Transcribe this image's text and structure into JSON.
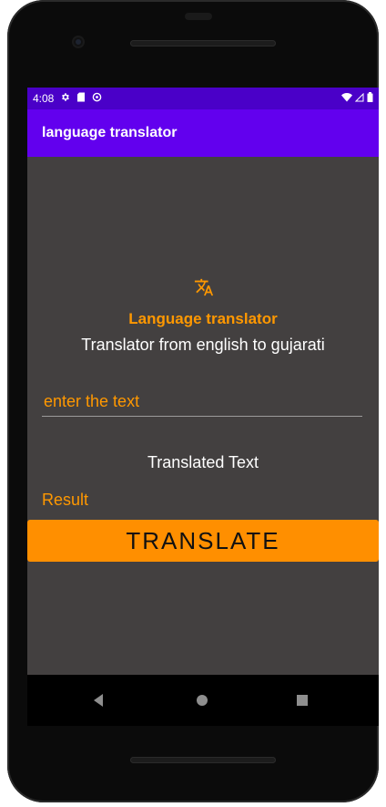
{
  "status_bar": {
    "time": "4:08",
    "left_icons": [
      "gear-icon",
      "sd-card-icon",
      "data-saver-icon"
    ],
    "right_icons": [
      "wifi-icon",
      "signal-icon",
      "battery-icon"
    ]
  },
  "app_bar": {
    "title": "language translator"
  },
  "main": {
    "icon": "translate-icon",
    "heading": "Language translator",
    "subheading": "Translator from english to gujarati",
    "input": {
      "value": "",
      "placeholder": "enter the text"
    },
    "translated_label": "Translated Text",
    "result_label": "Result",
    "translate_button_label": "TRANSLATE"
  },
  "nav_bar": {
    "icons": [
      "back-icon",
      "home-icon",
      "recents-icon"
    ]
  },
  "colors": {
    "status_bar": "#4a00c8",
    "app_bar": "#6200ee",
    "background": "#434040",
    "accent": "#ff9800",
    "button": "#ff8f00"
  }
}
